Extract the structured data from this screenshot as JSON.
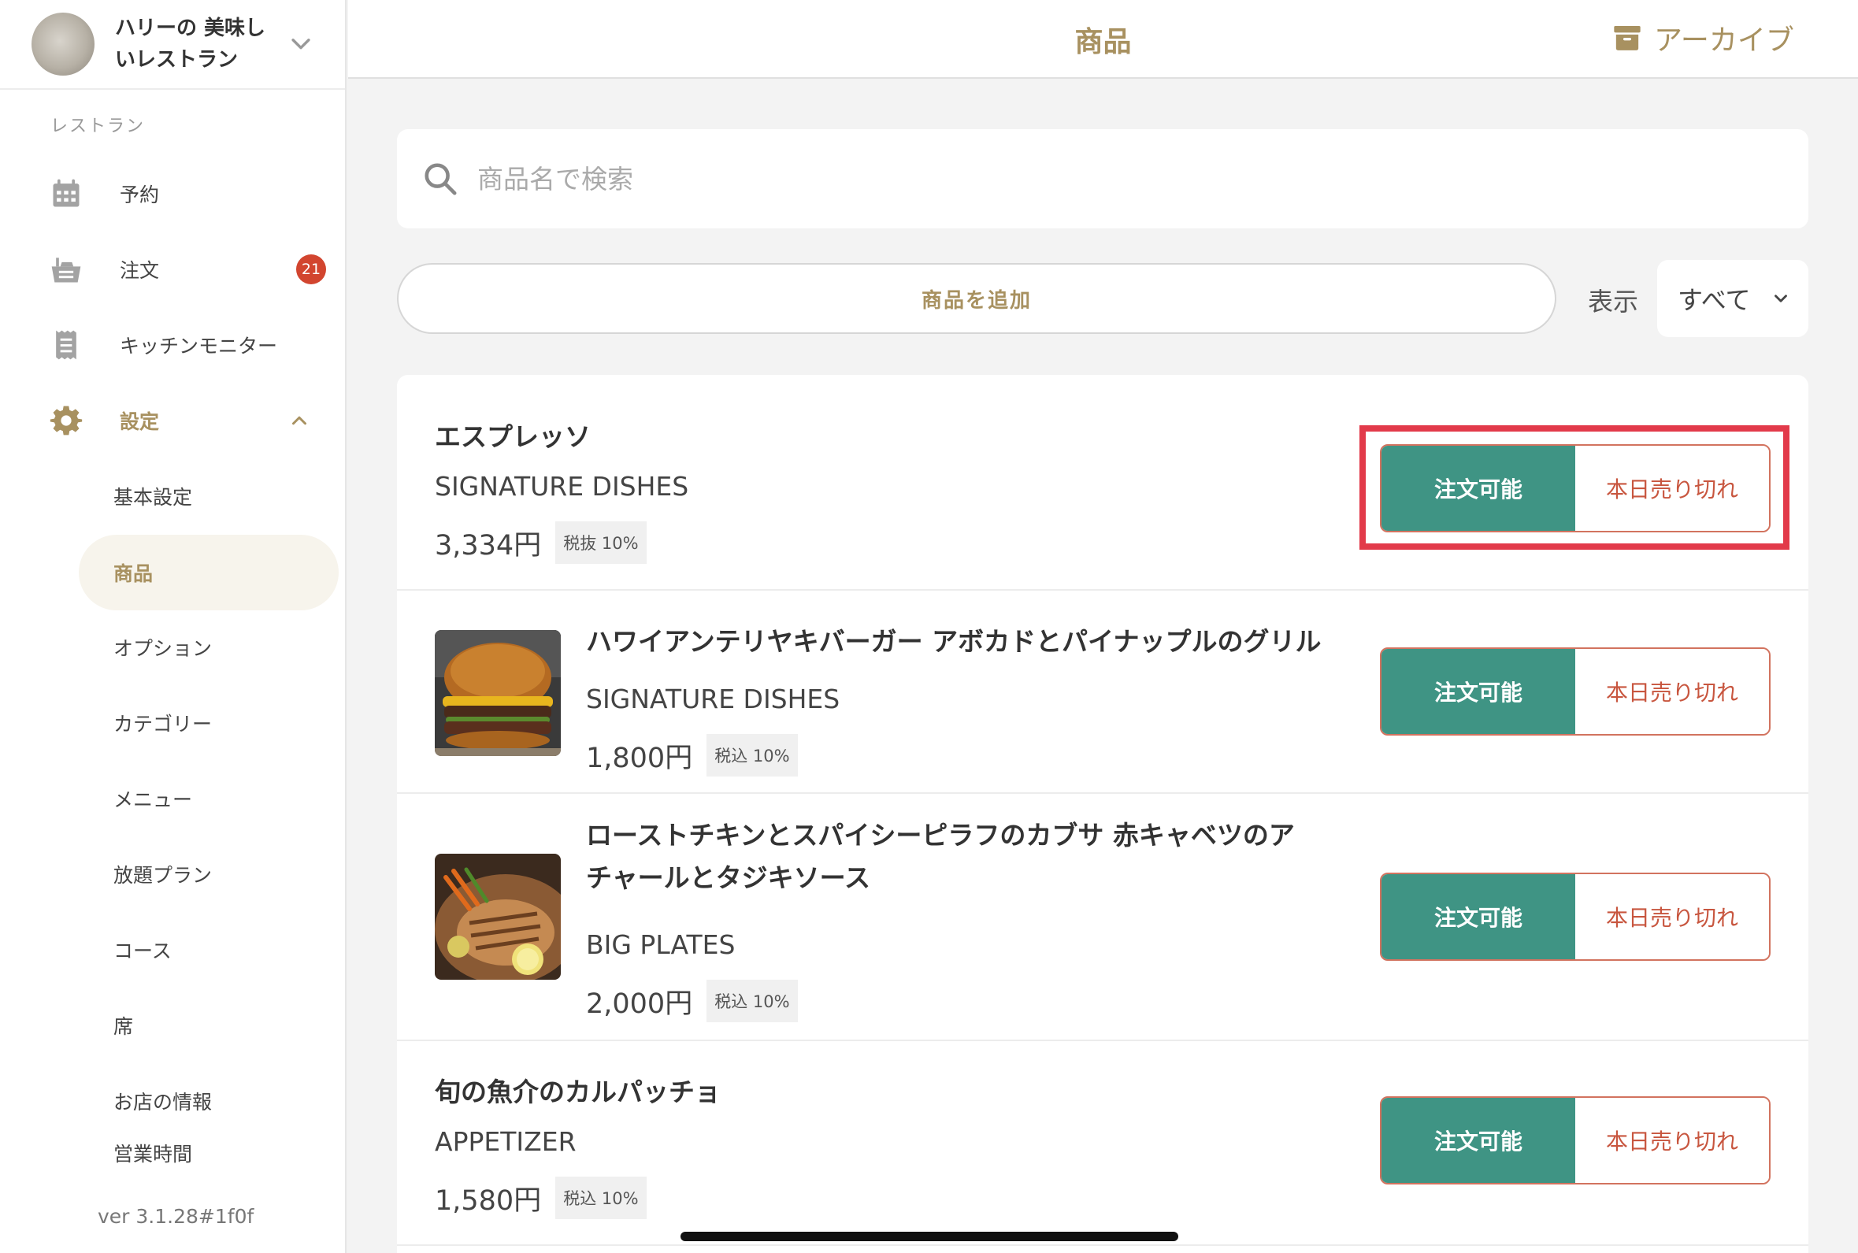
{
  "sidebar": {
    "restaurant_name": "ハリーの 美味しいレストラン",
    "section_label": "レストラン",
    "nav": {
      "reservations": "予約",
      "orders": "注文",
      "orders_badge": "21",
      "kitchen_monitor": "キッチンモニター",
      "settings": "設定"
    },
    "settings_items": [
      "基本設定",
      "商品",
      "オプション",
      "カテゴリー",
      "メニュー",
      "放題プラン",
      "コース",
      "席",
      "お店の情報",
      "営業時間"
    ],
    "version": "ver 3.1.28#1f0f"
  },
  "topbar": {
    "title": "商品",
    "archive": "アーカイブ"
  },
  "search": {
    "placeholder": "商品名で検索"
  },
  "toolbar": {
    "add_button": "商品を追加",
    "filter_label": "表示",
    "filter_value": "すべて"
  },
  "products": [
    {
      "name": "エスプレッソ",
      "category": "SIGNATURE DISHES",
      "price": "3,334円",
      "tax": "税抜 10%",
      "available_label": "注文可能",
      "soldout_label": "本日売り切れ"
    },
    {
      "name": "ハワイアンテリヤキバーガー アボカドとパイナップルのグリル",
      "category": "SIGNATURE DISHES",
      "price": "1,800円",
      "tax": "税込 10%",
      "available_label": "注文可能",
      "soldout_label": "本日売り切れ"
    },
    {
      "name": "ローストチキンとスパイシーピラフのカブサ 赤キャベツのアチャールとタジキソース",
      "category": "BIG PLATES",
      "price": "2,000円",
      "tax": "税込 10%",
      "available_label": "注文可能",
      "soldout_label": "本日売り切れ"
    },
    {
      "name": "旬の魚介のカルパッチョ",
      "category": "APPETIZER",
      "price": "1,580円",
      "tax": "税込 10%",
      "available_label": "注文可能",
      "soldout_label": "本日売り切れ"
    }
  ],
  "colors": {
    "accent": "#a89160",
    "available": "#3f9484",
    "soldout": "#c8563f",
    "badge": "#d2452f",
    "highlight": "#e23a4a"
  }
}
